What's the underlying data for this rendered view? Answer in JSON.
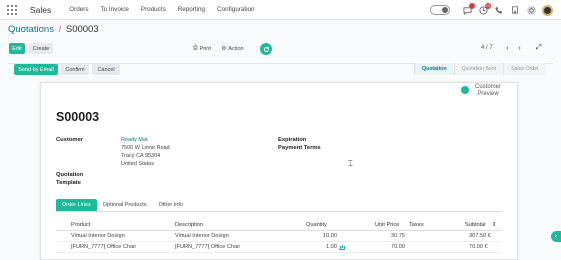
{
  "topbar": {
    "brand": "Sales",
    "menu": [
      "Orders",
      "To Invoice",
      "Products",
      "Reporting",
      "Configuration"
    ],
    "message_count": "",
    "activity_count": "23"
  },
  "breadcrumb": {
    "parent": "Quotations",
    "separator": "/",
    "current": "S00003"
  },
  "control": {
    "edit": "Edit",
    "create": "Create",
    "print": "Print",
    "action": "Action",
    "pager": "4 / 7"
  },
  "statusbar": {
    "buttons": [
      "Send by Email",
      "Confirm",
      "Cancel"
    ],
    "stages": [
      "Quotation",
      "Quotation Sent",
      "Sales Order"
    ],
    "active_stage": "Quotation"
  },
  "sheet": {
    "preview_line1": "Customer",
    "preview_line2": "Preview",
    "title": "S00003",
    "customer_label": "Customer",
    "customer_name": "Ready Mat",
    "address": [
      "7500 W Linne Road",
      "Tracy CA 95304",
      "United States"
    ],
    "expiration_label": "Expiration",
    "payment_terms_label": "Payment Terms",
    "template_label": [
      "Quotation",
      "Template"
    ]
  },
  "tabs": [
    "Order Lines",
    "Optional Products",
    "Other Info"
  ],
  "table": {
    "headers": [
      "Product",
      "Description",
      "Quantity",
      "Unit Price",
      "Taxes",
      "Subtotal"
    ],
    "rows": [
      {
        "product": "Virtual Interior Design",
        "description": "Virtual Interior Design",
        "quantity": "10.00",
        "unit_price": "30.75",
        "taxes": "",
        "subtotal": "307.50 €"
      },
      {
        "product": "[FURN_7777] Office Chair",
        "description": "[FURN_7777] Office Chair",
        "quantity": "1.00",
        "unit_price": "70.00",
        "taxes": "",
        "subtotal": "70.00 €"
      }
    ]
  },
  "colors": {
    "primary": "#21b799",
    "link": "#017e84"
  }
}
